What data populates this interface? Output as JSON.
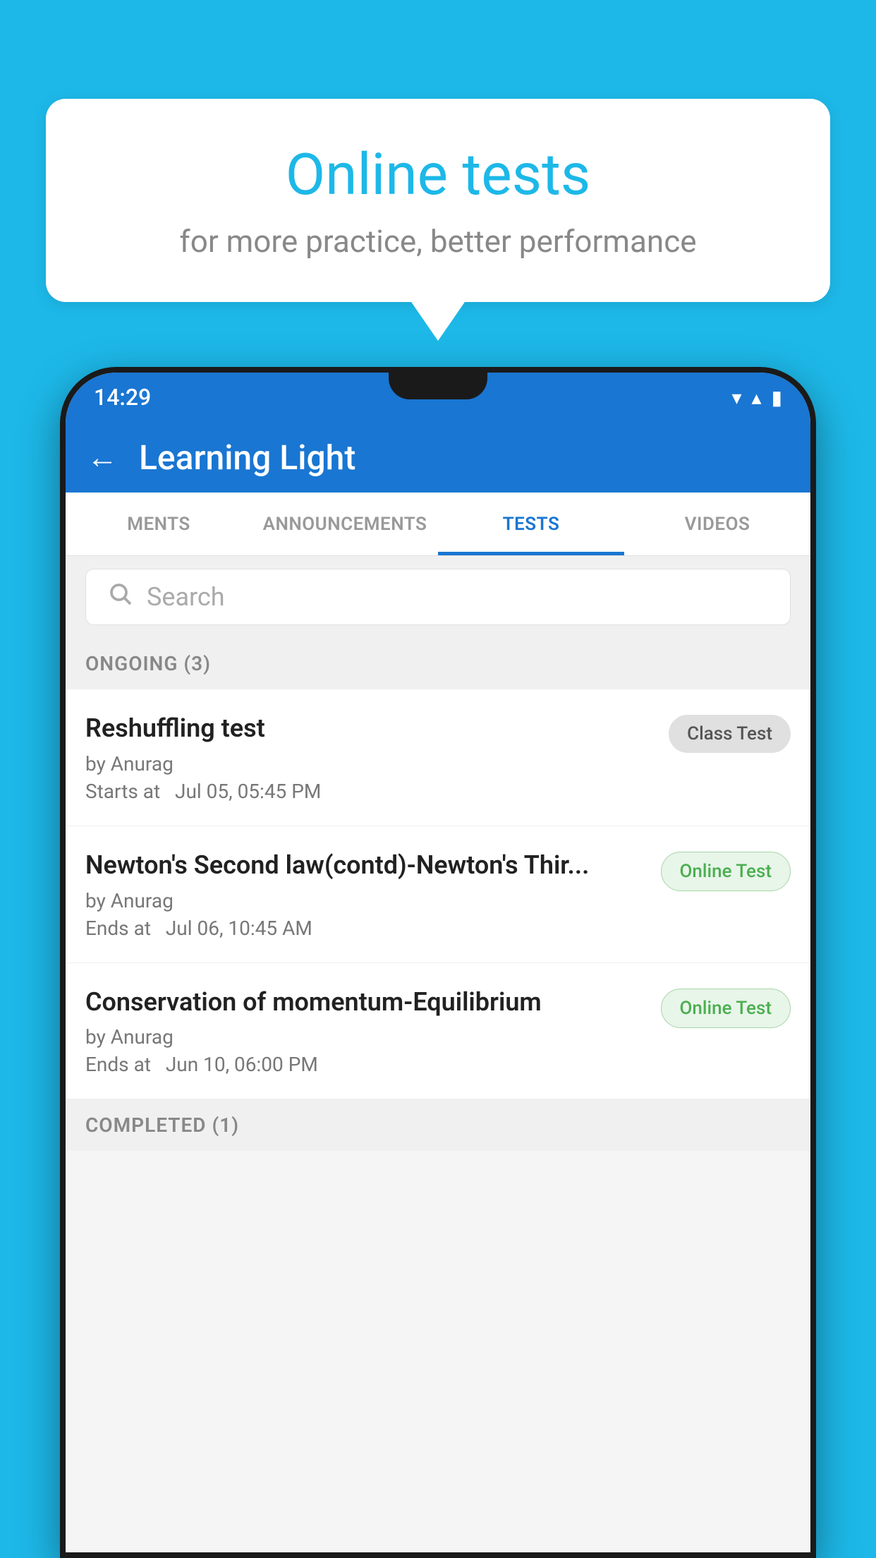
{
  "background_color": "#1DB8E8",
  "bubble": {
    "title": "Online tests",
    "subtitle": "for more practice, better performance"
  },
  "status_bar": {
    "time": "14:29",
    "wifi_icon": "▼",
    "signal_icon": "▲",
    "battery_icon": "▮"
  },
  "app_bar": {
    "title": "Learning Light",
    "back_label": "←"
  },
  "tabs": [
    {
      "label": "MENTS",
      "active": false
    },
    {
      "label": "ANNOUNCEMENTS",
      "active": false
    },
    {
      "label": "TESTS",
      "active": true
    },
    {
      "label": "VIDEOS",
      "active": false
    }
  ],
  "search": {
    "placeholder": "Search"
  },
  "sections": [
    {
      "label": "ONGOING (3)",
      "tests": [
        {
          "name": "Reshuffling test",
          "by": "by Anurag",
          "time_label": "Starts at",
          "time": "Jul 05, 05:45 PM",
          "badge_text": "Class Test",
          "badge_type": "class"
        },
        {
          "name": "Newton's Second law(contd)-Newton's Thir...",
          "by": "by Anurag",
          "time_label": "Ends at",
          "time": "Jul 06, 10:45 AM",
          "badge_text": "Online Test",
          "badge_type": "online"
        },
        {
          "name": "Conservation of momentum-Equilibrium",
          "by": "by Anurag",
          "time_label": "Ends at",
          "time": "Jun 10, 06:00 PM",
          "badge_text": "Online Test",
          "badge_type": "online"
        }
      ]
    }
  ],
  "completed_section_label": "COMPLETED (1)"
}
